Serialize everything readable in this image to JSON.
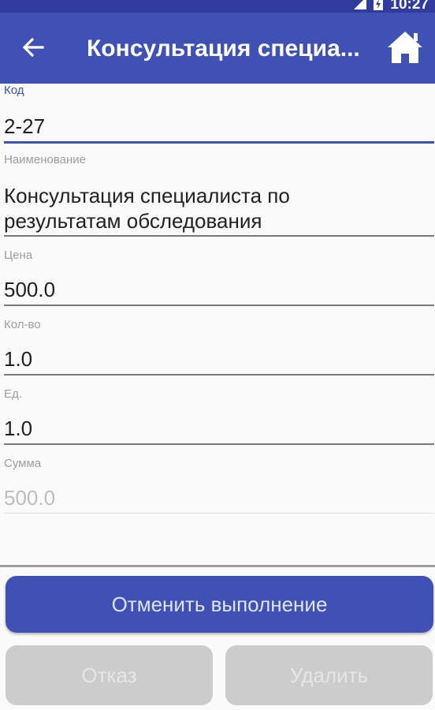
{
  "status_bar": {
    "time": "10:27",
    "signal_icon": "signal-icon",
    "battery_icon": "battery-icon"
  },
  "app_bar": {
    "title": "Консультация специа...",
    "back_icon": "arrow-back-icon",
    "home_icon": "home-icon",
    "color": "#3f51b5"
  },
  "form": {
    "code": {
      "label": "Код",
      "value": "2-27"
    },
    "name": {
      "label": "Наименование",
      "value_line1": "Консультация специалиста по",
      "value_line2": "результатам обследования"
    },
    "price": {
      "label": "Цена",
      "value": "500.0"
    },
    "quantity": {
      "label": "Кол-во",
      "value": "1.0"
    },
    "unit": {
      "label": "Ед.",
      "value": "1.0"
    },
    "sum": {
      "label": "Сумма",
      "value": "500.0"
    }
  },
  "actions": {
    "cancel_execution": "Отменить выполнение",
    "refuse": "Отказ",
    "delete": "Удалить"
  }
}
